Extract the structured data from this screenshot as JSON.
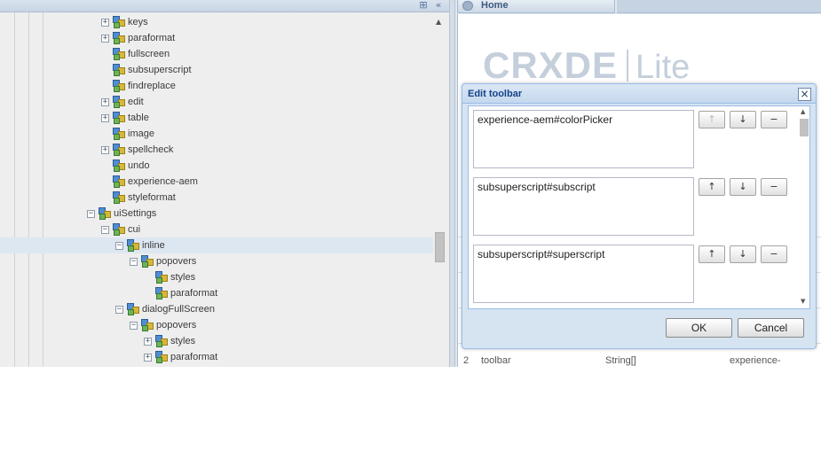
{
  "left_panel": {
    "collapse_icon": "collapse-icon",
    "tree": [
      {
        "label": "keys",
        "depth": 4,
        "expander": "+"
      },
      {
        "label": "paraformat",
        "depth": 4,
        "expander": "+"
      },
      {
        "label": "fullscreen",
        "depth": 4,
        "expander": ""
      },
      {
        "label": "subsuperscript",
        "depth": 4,
        "expander": ""
      },
      {
        "label": "findreplace",
        "depth": 4,
        "expander": ""
      },
      {
        "label": "edit",
        "depth": 4,
        "expander": "+"
      },
      {
        "label": "table",
        "depth": 4,
        "expander": "+"
      },
      {
        "label": "image",
        "depth": 4,
        "expander": ""
      },
      {
        "label": "spellcheck",
        "depth": 4,
        "expander": "+"
      },
      {
        "label": "undo",
        "depth": 4,
        "expander": ""
      },
      {
        "label": "experience-aem",
        "depth": 4,
        "expander": ""
      },
      {
        "label": "styleformat",
        "depth": 4,
        "expander": ""
      },
      {
        "label": "uiSettings",
        "depth": 3,
        "expander": "−"
      },
      {
        "label": "cui",
        "depth": 4,
        "expander": "−"
      },
      {
        "label": "inline",
        "depth": 5,
        "expander": "−",
        "selected": true
      },
      {
        "label": "popovers",
        "depth": 6,
        "expander": "−"
      },
      {
        "label": "styles",
        "depth": 7,
        "expander": ""
      },
      {
        "label": "paraformat",
        "depth": 7,
        "expander": ""
      },
      {
        "label": "dialogFullScreen",
        "depth": 5,
        "expander": "−"
      },
      {
        "label": "popovers",
        "depth": 6,
        "expander": "−"
      },
      {
        "label": "styles",
        "depth": 7,
        "expander": "+"
      },
      {
        "label": "paraformat",
        "depth": 7,
        "expander": "+"
      }
    ]
  },
  "right_panel": {
    "tab_label": "Home",
    "logo": {
      "word": "CRXDE",
      "suffix": "Lite"
    },
    "prop_row": {
      "index": "2",
      "name": "toolbar",
      "type": "String[]",
      "value": "experience-aem#colo"
    }
  },
  "dialog": {
    "title": "Edit toolbar",
    "close_glyph": "×",
    "items": [
      {
        "value": "experience-aem#colorPicker",
        "up_disabled": true
      },
      {
        "value": "subsuperscript#subscript",
        "up_disabled": false
      },
      {
        "value": "subsuperscript#superscript",
        "up_disabled": false
      }
    ],
    "up_glyph": "↑",
    "down_glyph": "↓",
    "remove_glyph": "−",
    "ok_label": "OK",
    "cancel_label": "Cancel"
  }
}
